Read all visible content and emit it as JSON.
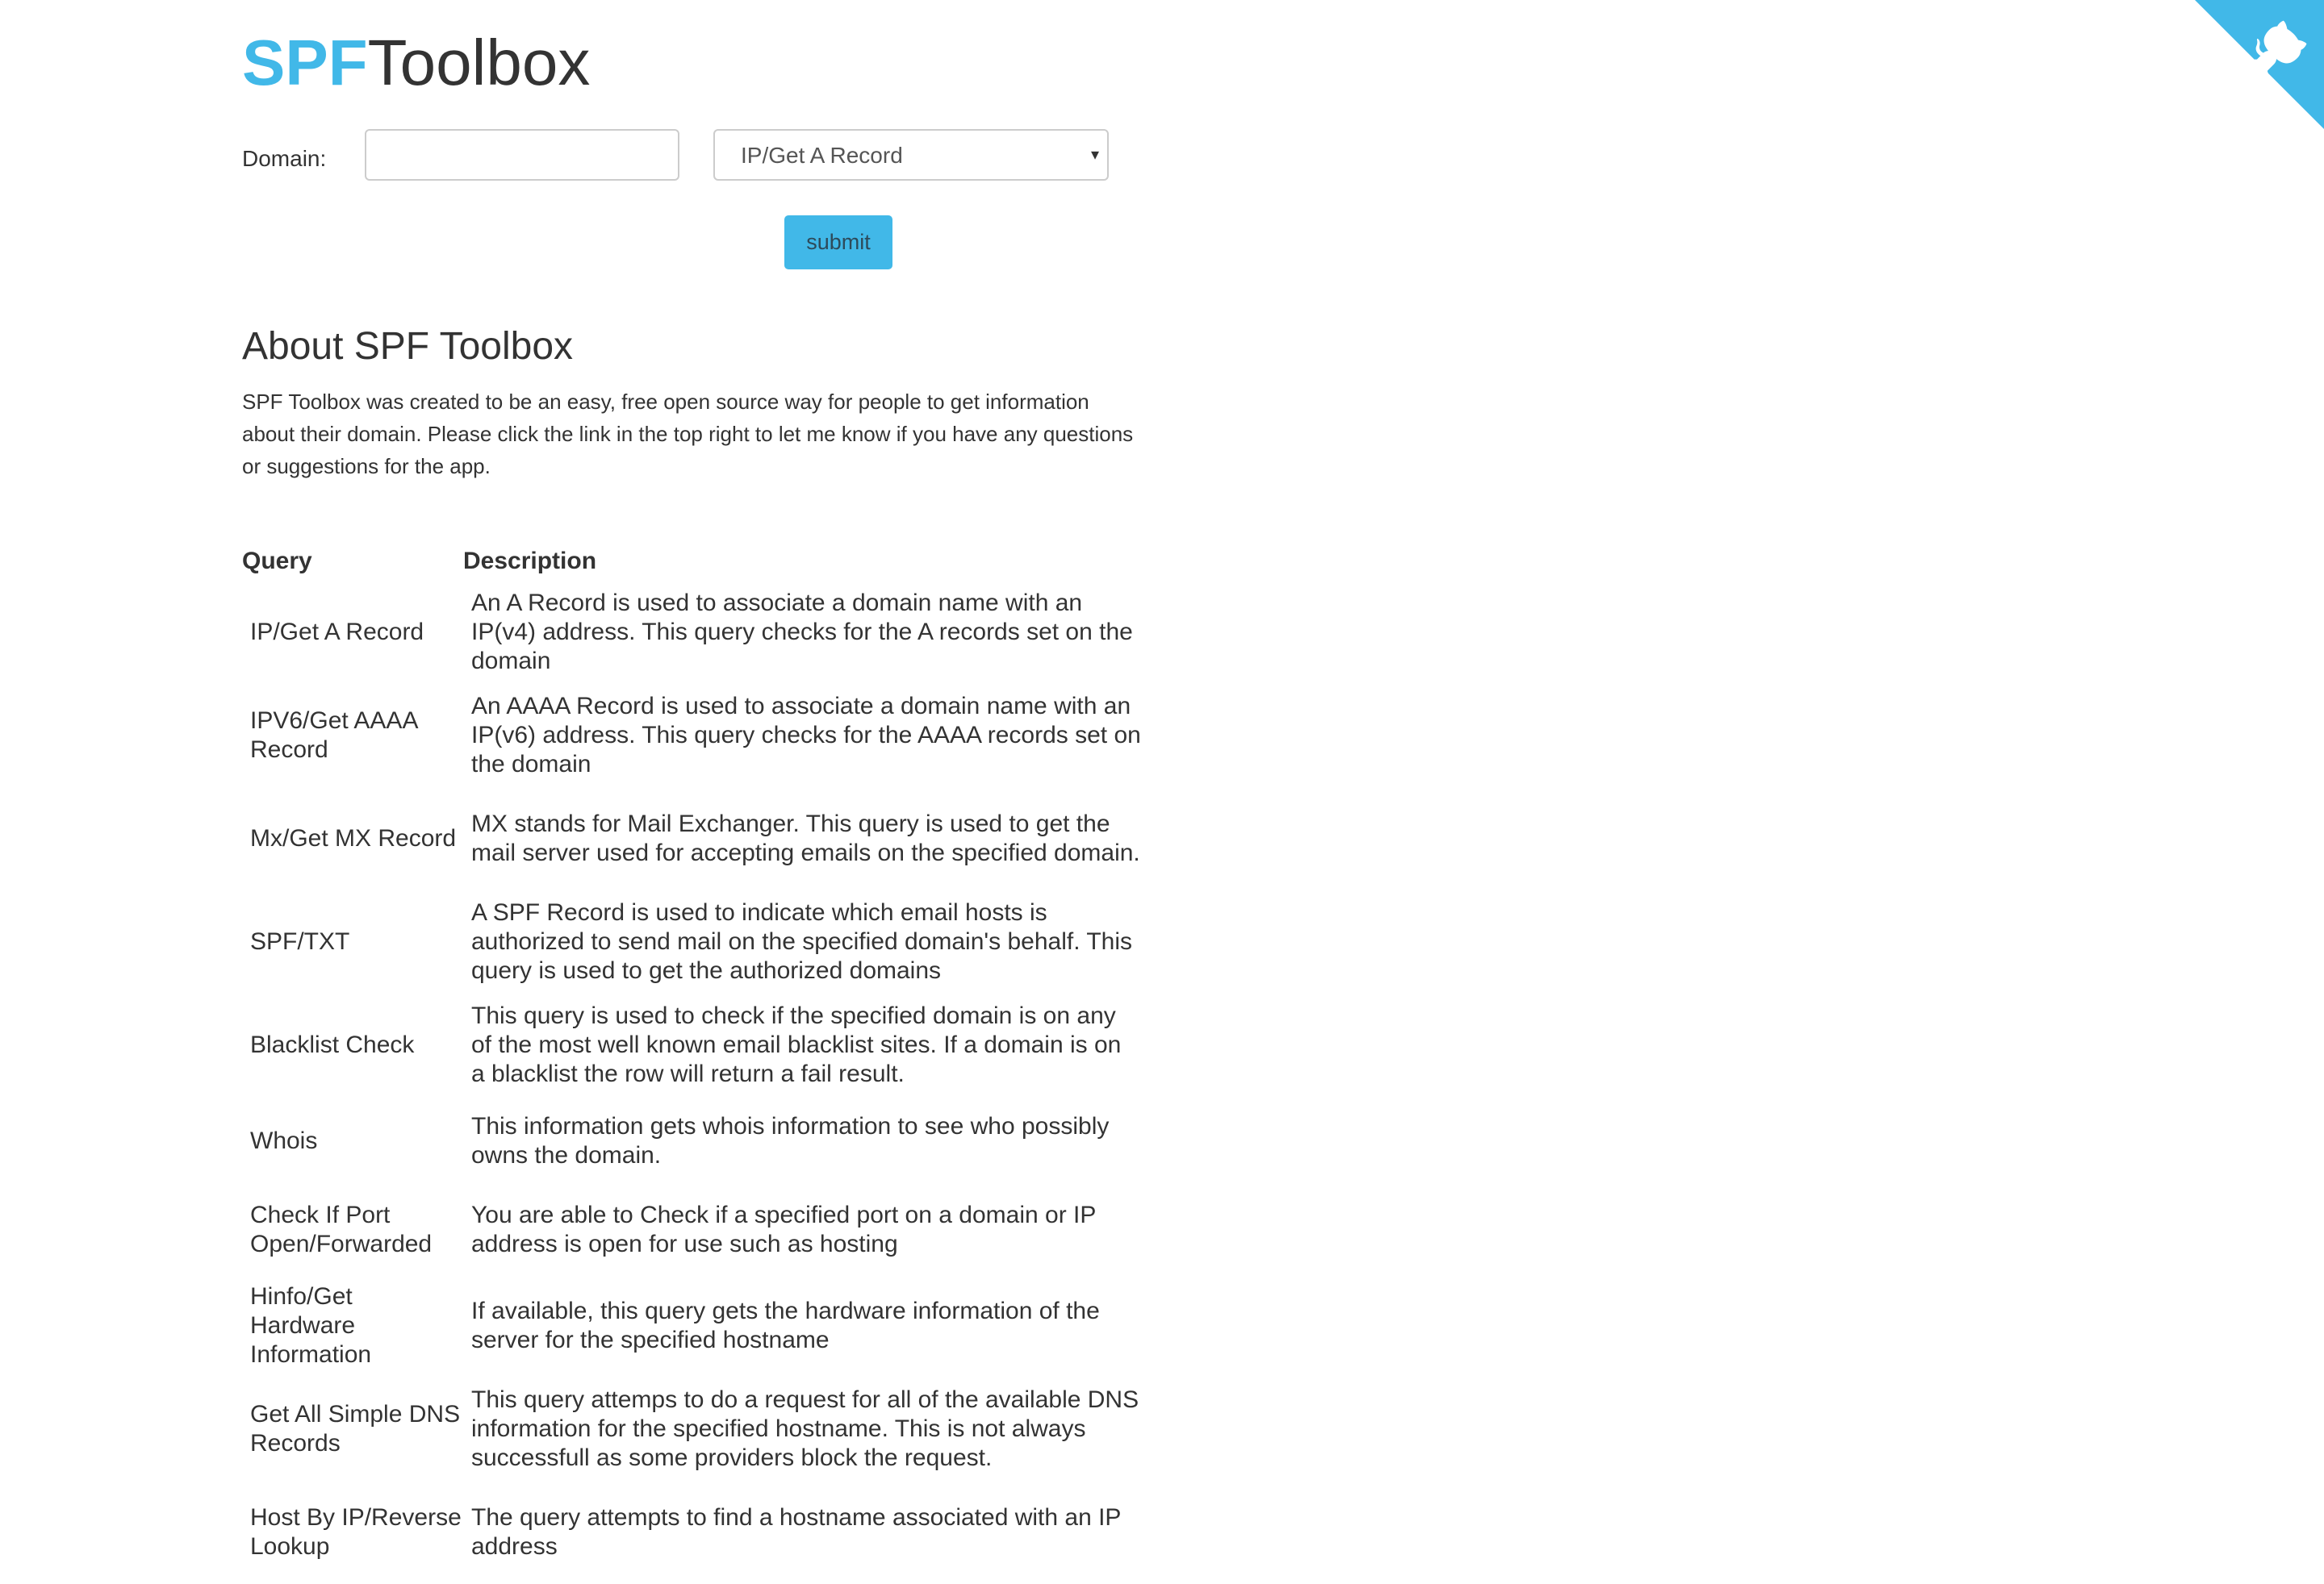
{
  "header": {
    "logo_brand": "SPF",
    "logo_rest": "Toolbox"
  },
  "form": {
    "domain_label": "Domain:",
    "domain_value": "",
    "domain_placeholder": "",
    "query_selected": "IP/Get A Record",
    "submit_label": "submit"
  },
  "about": {
    "heading": "About SPF Toolbox",
    "text": "SPF Toolbox was created to be an easy, free open source way for people to get information about their domain. Please click the link in the top right to let me know if you have any questions or suggestions for the app."
  },
  "table": {
    "headers": {
      "query": "Query",
      "description": "Description"
    },
    "rows": [
      {
        "query": "IP/Get A Record",
        "description": "An A Record is used to associate a domain name with an IP(v4) address. This query checks for the A records set on the domain"
      },
      {
        "query": "IPV6/Get AAAA Record",
        "description": "An AAAA Record is used to associate a domain name with an IP(v6) address. This query checks for the AAAA records set on the domain"
      },
      {
        "query": "Mx/Get MX Record",
        "description": "MX stands for Mail Exchanger. This query is used to get the mail server used for accepting emails on the specified domain."
      },
      {
        "query": "SPF/TXT",
        "description": "A SPF Record is used to indicate which email hosts is authorized to send mail on the specified domain's behalf. This query is used to get the authorized domains"
      },
      {
        "query": "Blacklist Check",
        "description": "This query is used to check if the specified domain is on any of the most well known email blacklist sites. If a domain is on a blacklist the row will return a fail result."
      },
      {
        "query": "Whois",
        "description": "This information gets whois information to see who possibly owns the domain."
      },
      {
        "query": "Check If Port Open/Forwarded",
        "description": "You are able to Check if a specified port on a domain or IP address is open for use such as hosting"
      },
      {
        "query": "Hinfo/Get Hardware Information",
        "description": "If available, this query gets the hardware information of the server for the specified hostname"
      },
      {
        "query": "Get All Simple DNS Records",
        "description": "This query attemps to do a request for all of the available DNS information for the specified hostname. This is not always successfull as some providers block the request."
      },
      {
        "query": "Host By IP/Reverse Lookup",
        "description": "The query attempts to find a hostname associated with an IP address"
      }
    ]
  },
  "corner_ribbon": {
    "icon": "github-octocat-icon",
    "color": "#41b8e8"
  },
  "colors": {
    "accent": "#41b8e8",
    "text": "#333333"
  }
}
